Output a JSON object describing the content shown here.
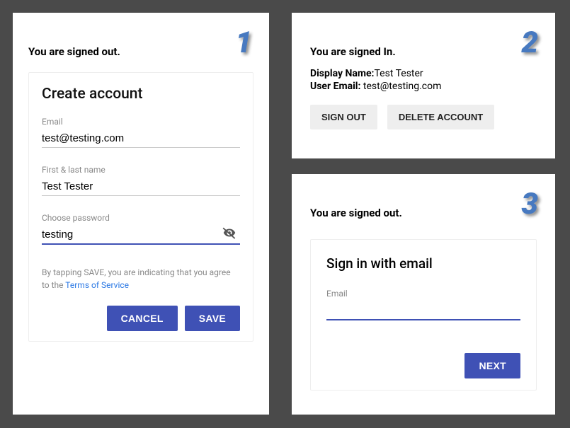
{
  "panel1": {
    "num": "1",
    "status": "You are signed out.",
    "card_title": "Create account",
    "fields": {
      "email": {
        "label": "Email",
        "value": "test@testing.com"
      },
      "name": {
        "label": "First & last name",
        "value": "Test Tester"
      },
      "password": {
        "label": "Choose password",
        "value": "testing"
      }
    },
    "tos_text": "By tapping SAVE, you are indicating that you agree to the ",
    "tos_link": "Terms of Service",
    "cancel_label": "CANCEL",
    "save_label": "SAVE"
  },
  "panel2": {
    "num": "2",
    "status": "You are signed In.",
    "display_name_label": "Display Name:",
    "display_name_value": "Test Tester",
    "user_email_label": "User Email: ",
    "user_email_value": "test@testing.com",
    "sign_out_label": "SIGN OUT",
    "delete_label": "DELETE ACCOUNT"
  },
  "panel3": {
    "num": "3",
    "status": "You are signed out.",
    "card_title": "Sign in with email",
    "email_label": "Email",
    "email_value": "",
    "next_label": "NEXT"
  }
}
